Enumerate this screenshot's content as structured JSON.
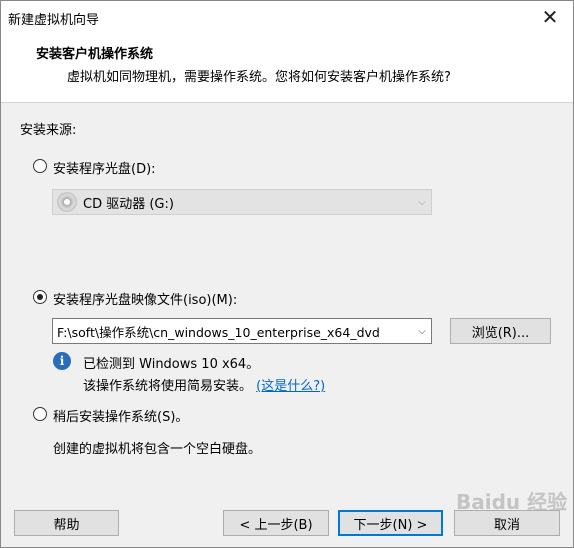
{
  "window": {
    "title": "新建虚拟机向导",
    "close_glyph": "✕"
  },
  "header": {
    "title": "安装客户机操作系统",
    "subtitle": "虚拟机如同物理机，需要操作系统。您将如何安装客户机操作系统?"
  },
  "source": {
    "label": "安装来源:",
    "disc_option": {
      "label": "安装程序光盘(D):",
      "checked": false
    },
    "disc_combo": {
      "value": "CD 驱动器 (G:)",
      "icon": "cd-drive-icon"
    },
    "iso_option": {
      "label": "安装程序光盘映像文件(iso)(M):",
      "checked": true
    },
    "iso_combo": {
      "value": "F:\\soft\\操作系统\\cn_windows_10_enterprise_x64_dvd"
    },
    "browse_label": "浏览(R)...",
    "detected_text": "已检测到 Windows 10 x64。",
    "easy_install_text": "该操作系统将使用简易安装。",
    "what_is_this_link": "(这是什么?)",
    "later_option": {
      "label": "稍后安装操作系统(S)。",
      "checked": false
    },
    "later_desc": "创建的虚拟机将包含一个空白硬盘。"
  },
  "footer": {
    "help_label": "帮助",
    "back_label": "< 上一步(B)",
    "next_label": "下一步(N) >",
    "cancel_label": "取消"
  },
  "watermark": "Baidu 经验",
  "colors": {
    "accent": "#0078d7",
    "link": "#0066cc",
    "info_icon": "#2a6ebb"
  }
}
